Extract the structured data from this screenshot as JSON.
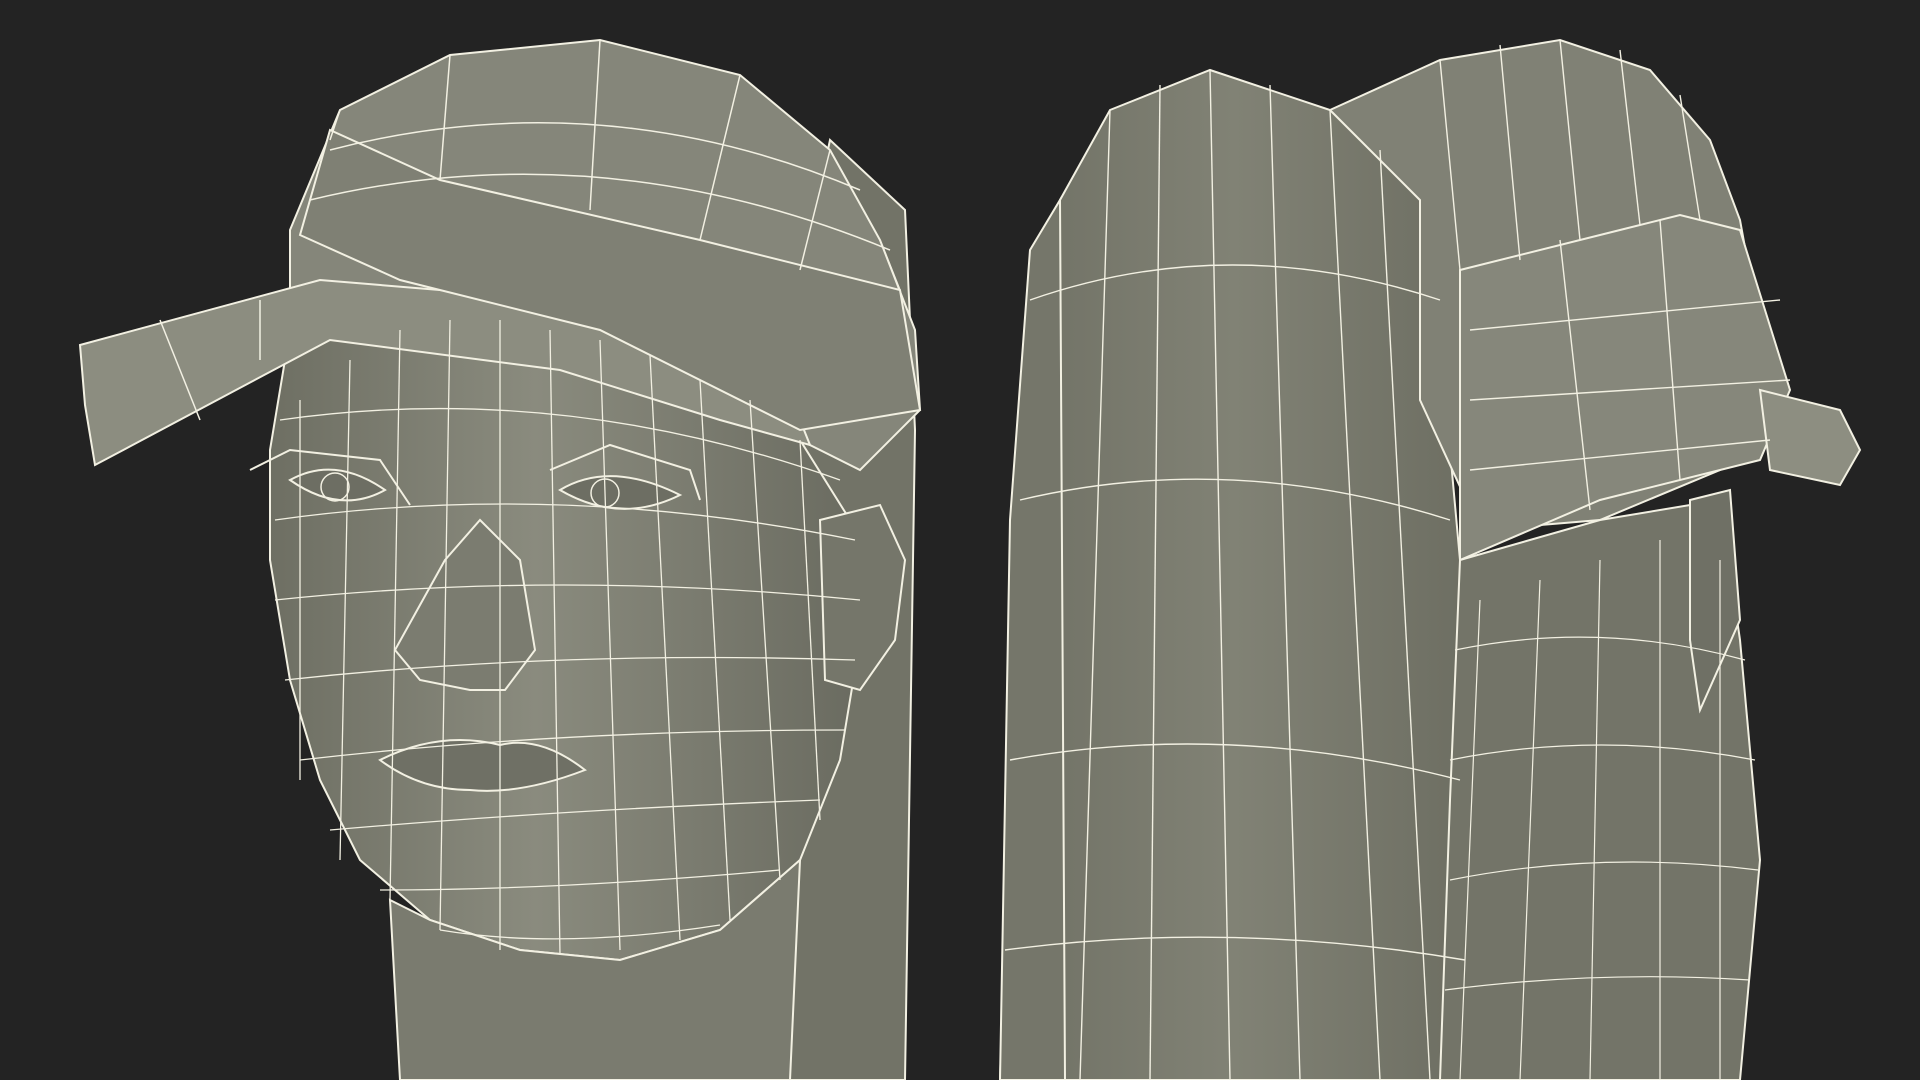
{
  "image": {
    "subject": "wireframe-render",
    "views": [
      "front-three-quarter-view",
      "back-three-quarter-view"
    ]
  },
  "colors": {
    "background": "#232323",
    "surface": "#7c7d70",
    "surface_light": "#8a8b7e",
    "surface_dark": "#5f6056",
    "wire": "#f2f0e2"
  }
}
